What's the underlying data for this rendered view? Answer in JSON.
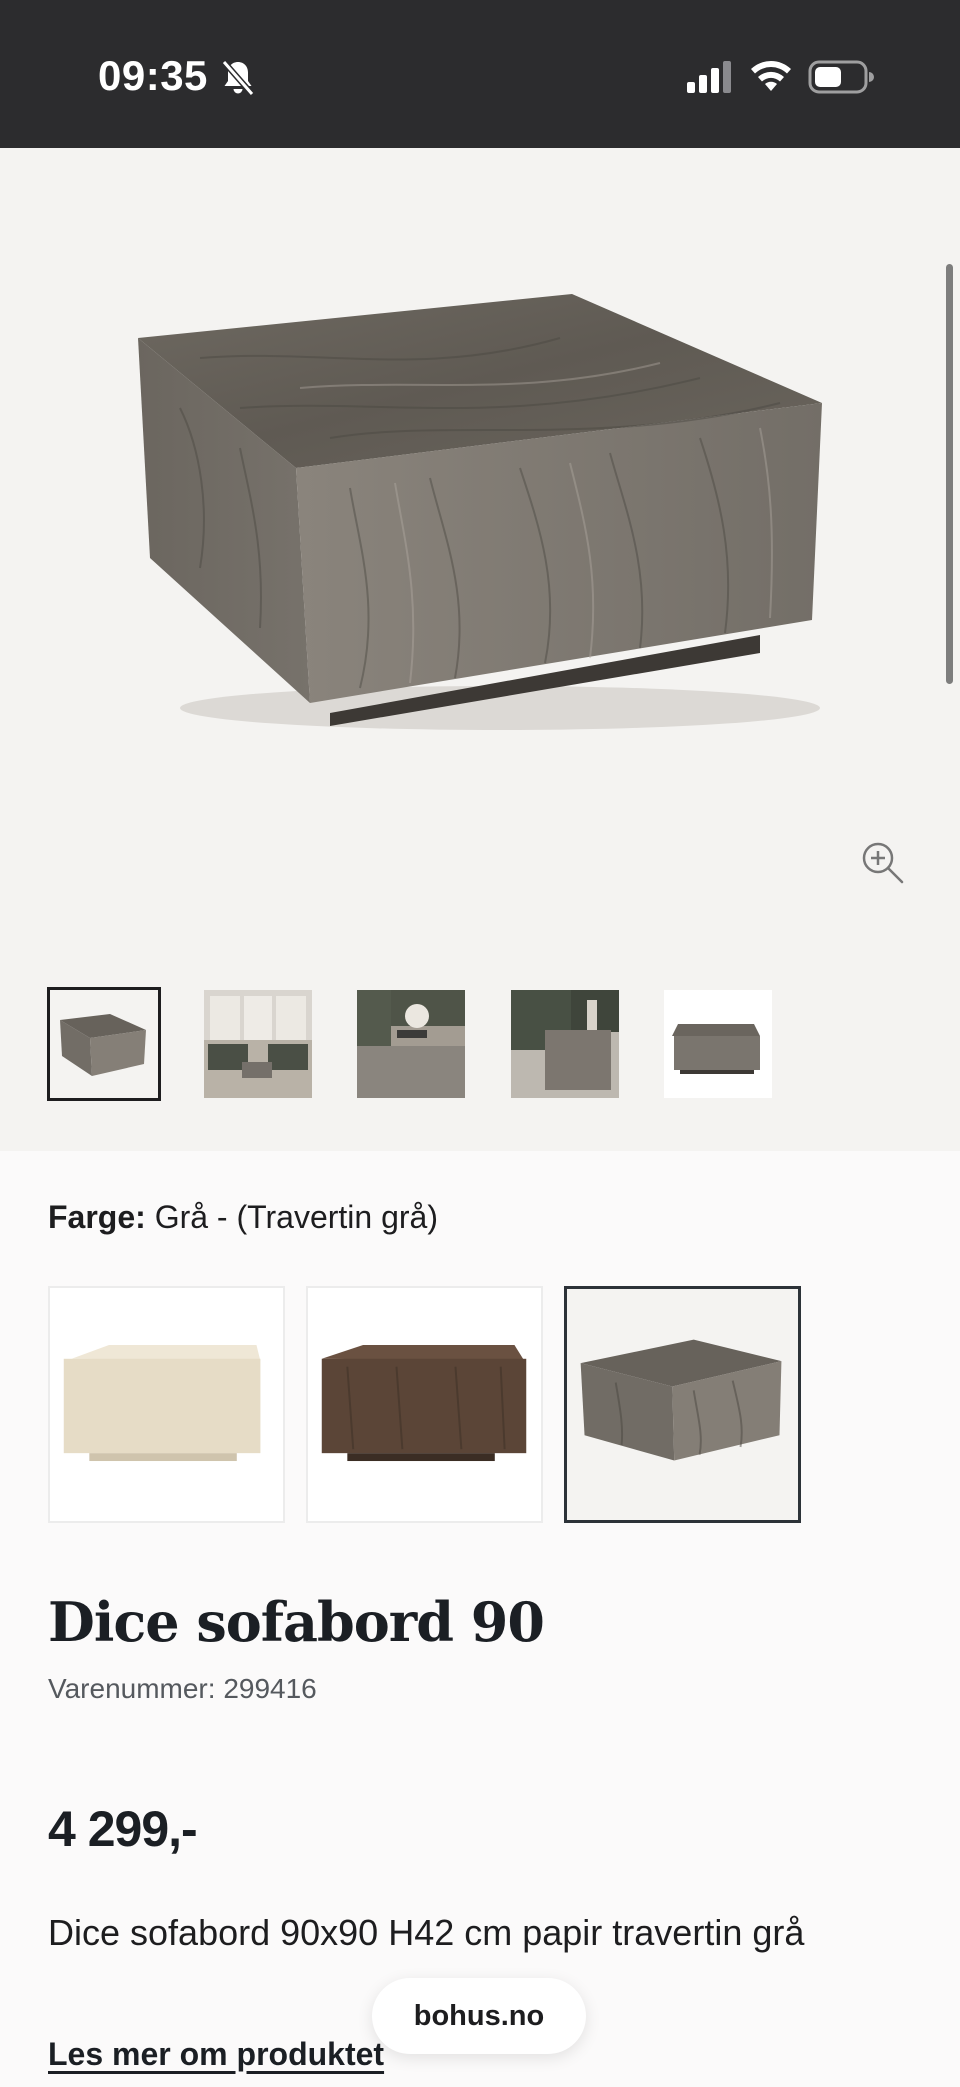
{
  "status_bar": {
    "time": "09:35",
    "icons": [
      "bell-slash-icon",
      "cellular-signal-icon",
      "wifi-icon",
      "battery-icon"
    ]
  },
  "gallery": {
    "main_image_alt": "Dice sofabord 90 – travertin grå",
    "zoom_icon": "zoom-in-icon",
    "thumbnails": [
      {
        "name": "product-front",
        "selected": true
      },
      {
        "name": "living-room-wide",
        "selected": false
      },
      {
        "name": "living-room-table-decor",
        "selected": false
      },
      {
        "name": "living-room-closeup",
        "selected": false
      },
      {
        "name": "product-side",
        "selected": false
      }
    ]
  },
  "color": {
    "label": "Farge:",
    "value": "Grå - (Travertin grå)",
    "options": [
      {
        "name": "travertin-beige",
        "color": "#e8ddc8",
        "selected": false
      },
      {
        "name": "dark-wood",
        "color": "#5b4537",
        "selected": false
      },
      {
        "name": "travertin-gra",
        "color": "#75706a",
        "selected": true
      }
    ]
  },
  "product": {
    "title": "Dice sofabord 90",
    "sku": "Varenummer: 299416",
    "price": "4 299,-",
    "description": "Dice sofabord 90x90 H42 cm papir travertin grå",
    "read_more": "Les mer om produktet"
  },
  "browser": {
    "url": "bohus.no"
  }
}
